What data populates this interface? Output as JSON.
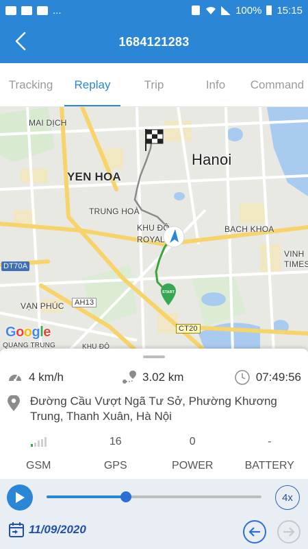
{
  "status_bar": {
    "left_more": "...",
    "battery": "100%",
    "time": "15:15"
  },
  "app_bar": {
    "title": "1684121283"
  },
  "tabs": [
    {
      "label": "Tracking",
      "active": false
    },
    {
      "label": "Replay",
      "active": true
    },
    {
      "label": "Trip",
      "active": false
    },
    {
      "label": "Info",
      "active": false
    },
    {
      "label": "Command",
      "active": false
    }
  ],
  "map": {
    "labels": {
      "mai_dich": "MAI DỊCH",
      "hanoi": "Hanoi",
      "yen_hoa": "YEN HOA",
      "trung_hoa": "TRUNG HOÀ",
      "khu_do": "KHU ĐÔ",
      "royal": "ROYAL",
      "bach_khoa": "BACH KHOA",
      "vinh": "VINH",
      "times": "TIMES",
      "dt70a": "DT70A",
      "van_phuc": "VẠN PHÚC",
      "ah13": "AH13",
      "ct20": "CT20",
      "quang_trung": "QUANG TRUNG",
      "khu_do2": "KHU ĐÔ"
    },
    "start_marker": "START",
    "logo": "Google"
  },
  "panel": {
    "speed": "4 km/h",
    "distance": "3.02 km",
    "time": "07:49:56",
    "address": "Đường Cầu Vượt Ngã Tư Sở, Phường Khương Trung, Thanh Xuân, Hà Nội",
    "sensors": [
      {
        "name": "GSM",
        "value": "",
        "signal_bars_on": 1,
        "signal_bars_total": 5
      },
      {
        "name": "GPS",
        "value": "16"
      },
      {
        "name": "POWER",
        "value": "0"
      },
      {
        "name": "BATTERY",
        "value": "-"
      }
    ]
  },
  "player": {
    "progress": 0.37,
    "speed_label": "4x",
    "date": "11/09/2020"
  },
  "colors": {
    "primary": "#2b86d6",
    "route_traveled": "#3aa53a",
    "route_upcoming": "#8a8a8a"
  }
}
